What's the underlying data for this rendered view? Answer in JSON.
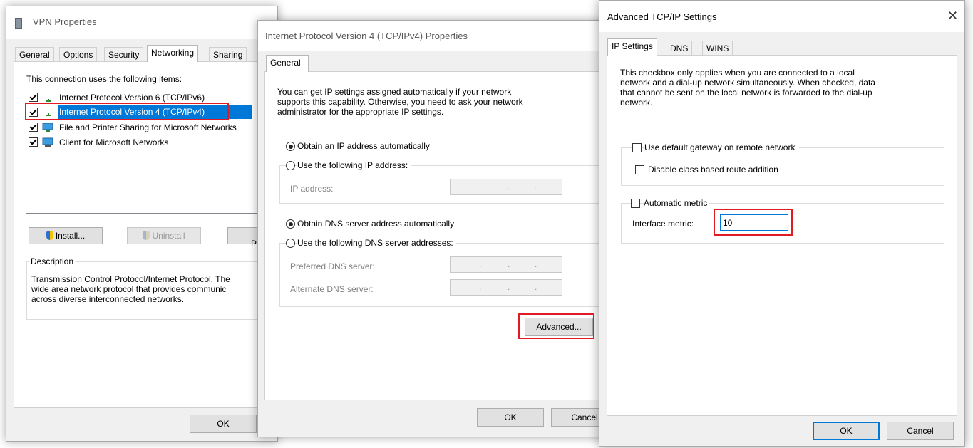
{
  "vpn": {
    "title": "VPN Properties",
    "tabs": [
      "General",
      "Options",
      "Security",
      "Networking",
      "Sharing"
    ],
    "uses_label": "This connection uses the following items:",
    "items": [
      {
        "label": "Internet Protocol Version 6 (TCP/IPv6)",
        "checked": true,
        "icon": "network-protocol-icon"
      },
      {
        "label": "Internet Protocol Version 4 (TCP/IPv4)",
        "checked": true,
        "icon": "network-protocol-icon"
      },
      {
        "label": "File and Printer Sharing for Microsoft Networks",
        "checked": true,
        "icon": "network-service-icon"
      },
      {
        "label": "Client for Microsoft Networks",
        "checked": true,
        "icon": "network-client-icon"
      }
    ],
    "install_label": "Install...",
    "uninstall_label": "Uninstall",
    "properties_label": "Pr",
    "description_label": "Description",
    "description_lines": [
      "Transmission Control Protocol/Internet Protocol. The",
      "wide area network protocol that provides communic",
      "across diverse interconnected networks."
    ],
    "ok_label": "OK"
  },
  "ipv4": {
    "title": "Internet Protocol Version 4 (TCP/IPv4) Properties",
    "tab": "General",
    "intro_lines": [
      "You can get IP settings assigned automatically if your network",
      "supports this capability. Otherwise, you need to ask your network",
      "administrator for the appropriate IP settings."
    ],
    "obtain_ip": "Obtain an IP address automatically",
    "use_ip": "Use the following IP address:",
    "ip_address_label": "IP address:",
    "obtain_dns": "Obtain DNS server address automatically",
    "use_dns": "Use the following DNS server addresses:",
    "preferred_dns_label": "Preferred DNS server:",
    "alternate_dns_label": "Alternate DNS server:",
    "ip_dot": ".",
    "advanced_label": "Advanced...",
    "ok_label": "OK",
    "cancel_label": "Cancel"
  },
  "advanced": {
    "title": "Advanced TCP/IP Settings",
    "close_glyph": "✕",
    "tabs": [
      "IP Settings",
      "DNS",
      "WINS"
    ],
    "info_lines": [
      "This checkbox only applies when you are connected to a local",
      "network and a dial-up network simultaneously.  When checked, data",
      "that cannot be sent on the local network is forwarded to the dial-up",
      "network."
    ],
    "default_gateway_label": "Use default gateway on remote network",
    "disable_class_label": "Disable class based route addition",
    "automatic_metric_label": "Automatic metric",
    "interface_metric_label": "Interface metric:",
    "interface_metric_value": "10",
    "ok_label": "OK",
    "cancel_label": "Cancel"
  },
  "colors": {
    "highlight_box": "#e01b24",
    "selection": "#0078d7",
    "window_bg": "#f0f0f0"
  }
}
